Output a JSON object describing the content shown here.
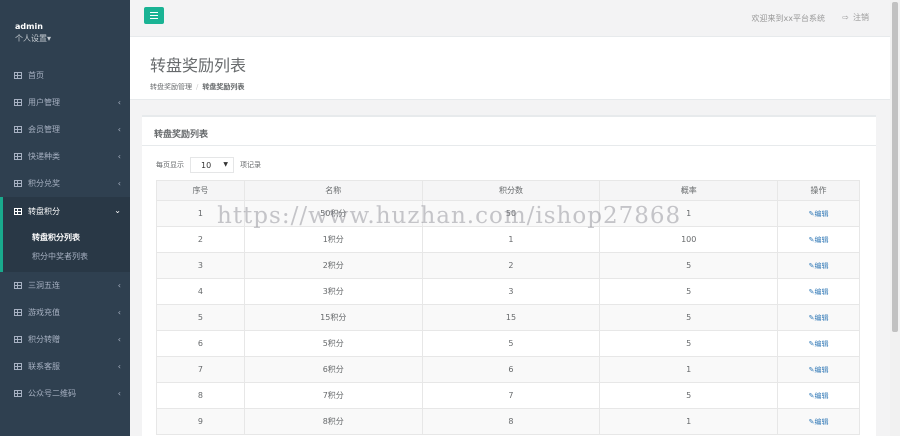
{
  "profile": {
    "name": "admin",
    "settings": "个人设置▾"
  },
  "sidebar": {
    "items": [
      {
        "label": "首页",
        "icon": "grid-icon"
      },
      {
        "label": "用户管理",
        "icon": "grid-icon",
        "arrow": "‹"
      },
      {
        "label": "会员管理",
        "icon": "grid-icon",
        "arrow": "‹"
      },
      {
        "label": "快递种类",
        "icon": "grid-icon",
        "arrow": "‹"
      },
      {
        "label": "积分兑奖",
        "icon": "grid-icon",
        "arrow": "‹"
      },
      {
        "label": "转盘积分",
        "icon": "grid-icon",
        "arrow": "⌄",
        "active": true
      },
      {
        "label": "三洞五连",
        "icon": "grid-icon",
        "arrow": "‹"
      },
      {
        "label": "游戏充值",
        "icon": "grid-icon",
        "arrow": "‹"
      },
      {
        "label": "积分转赠",
        "icon": "grid-icon",
        "arrow": "‹"
      },
      {
        "label": "联系客服",
        "icon": "grid-icon",
        "arrow": "‹"
      },
      {
        "label": "公众号二维码",
        "icon": "grid-icon",
        "arrow": "‹"
      }
    ],
    "submenu": [
      {
        "label": "转盘积分列表",
        "current": true
      },
      {
        "label": "积分中奖者列表"
      }
    ]
  },
  "topbar": {
    "welcome": "欢迎来到xx平台系统",
    "logout_icon": "⇨",
    "logout": "注销"
  },
  "heading": {
    "title": "转盘奖励列表",
    "breadcrumb_parent": "转盘奖励管理",
    "breadcrumb_sep": "/",
    "breadcrumb_current": "转盘奖励列表"
  },
  "ibox": {
    "title": "转盘奖励列表",
    "length_prefix": "每页显示",
    "length_value": "10",
    "length_suffix": "项记录"
  },
  "table": {
    "headers": [
      "序号",
      "名称",
      "积分数",
      "概率",
      "操作"
    ],
    "edit_label": "编辑",
    "rows": [
      [
        "1",
        "50积分",
        "50",
        "1"
      ],
      [
        "2",
        "1积分",
        "1",
        "100"
      ],
      [
        "3",
        "2积分",
        "2",
        "5"
      ],
      [
        "4",
        "3积分",
        "3",
        "5"
      ],
      [
        "5",
        "15积分",
        "15",
        "5"
      ],
      [
        "6",
        "5积分",
        "5",
        "5"
      ],
      [
        "7",
        "6积分",
        "6",
        "1"
      ],
      [
        "8",
        "7积分",
        "7",
        "5"
      ],
      [
        "9",
        "8积分",
        "8",
        "1"
      ]
    ]
  },
  "watermark": "https://www.huzhan.com/ishop27868",
  "colors": {
    "sidebar": "#2f4050",
    "accent": "#1ab394",
    "link": "#337ab7"
  }
}
